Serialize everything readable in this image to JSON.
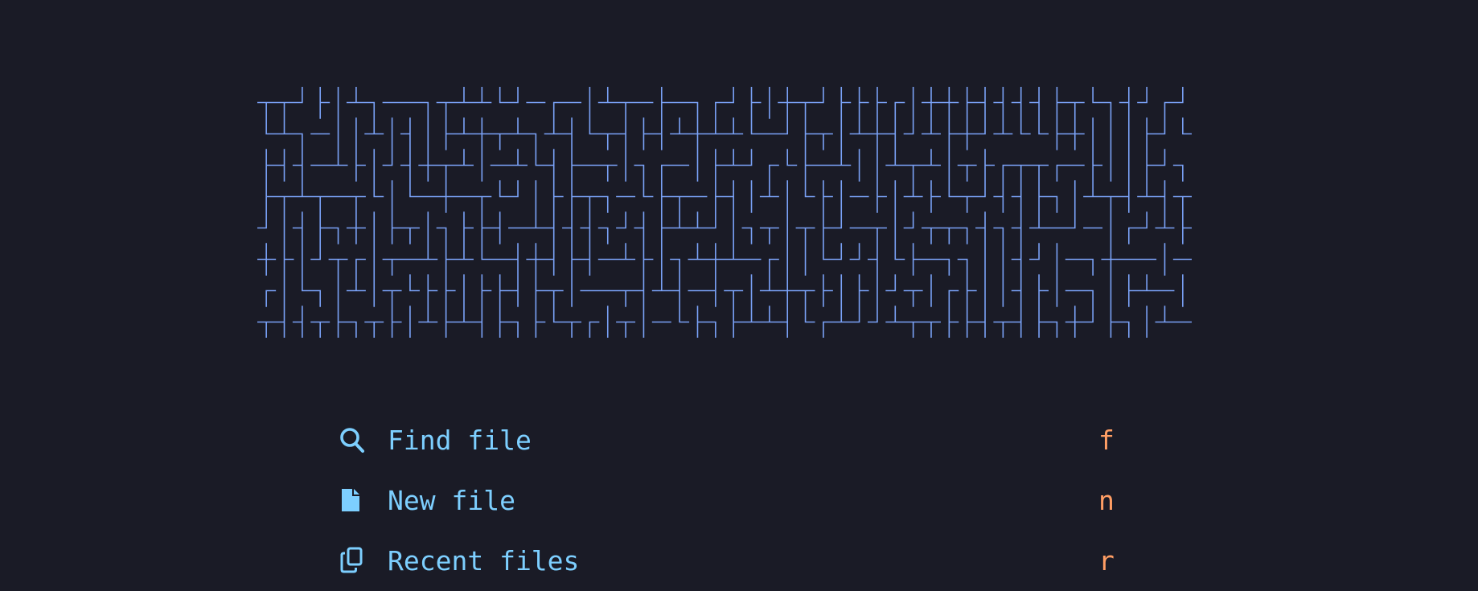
{
  "colors": {
    "background": "#1a1b26",
    "banner": "#7aa2f7",
    "label": "#7dcfff",
    "key": "#ff9e64"
  },
  "banner": {
    "cols": 52,
    "rows": 8,
    "seed": 1729
  },
  "menu": {
    "items": [
      {
        "icon": "search-icon",
        "label": "Find file",
        "key": "f"
      },
      {
        "icon": "file-icon",
        "label": "New file",
        "key": "n"
      },
      {
        "icon": "copy-icon",
        "label": "Recent files",
        "key": "r"
      }
    ]
  }
}
